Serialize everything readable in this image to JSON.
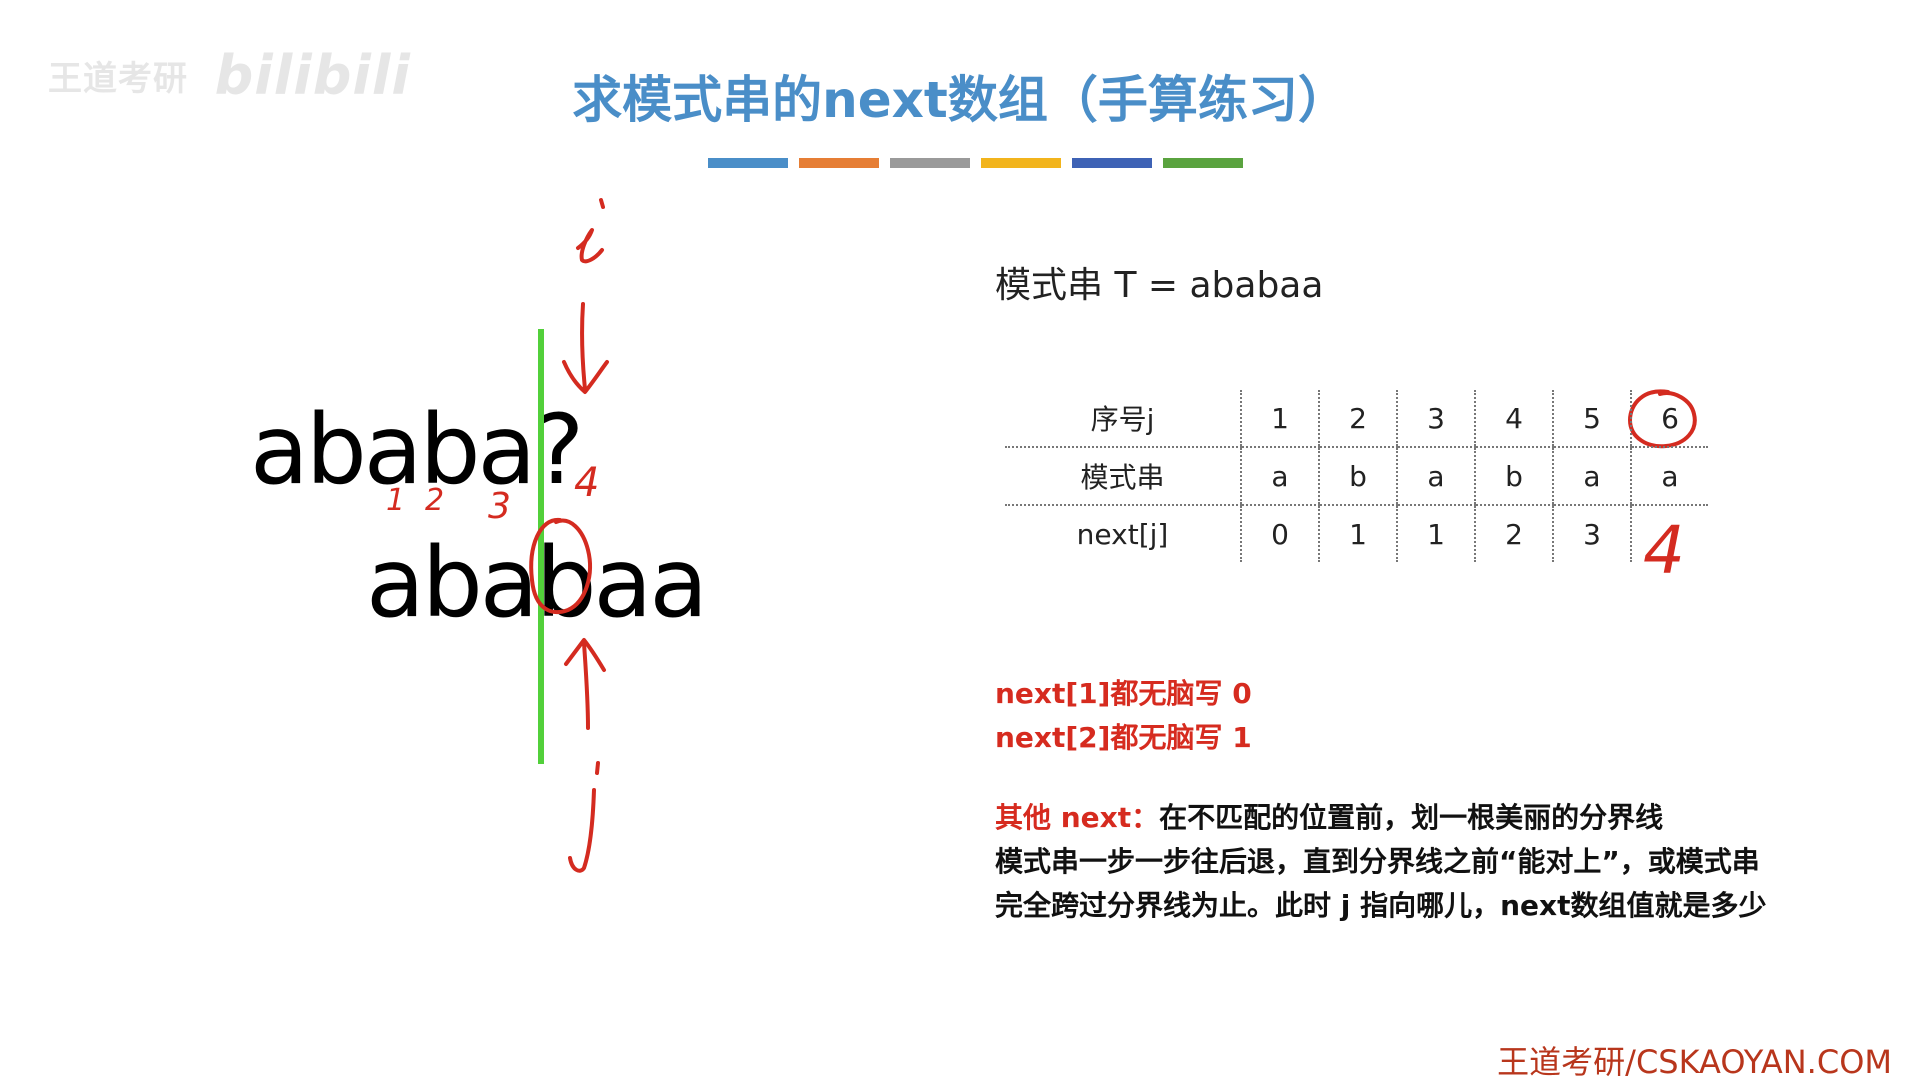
{
  "watermark": {
    "chinese": "王道考研",
    "brand": "bilibili"
  },
  "title": "求模式串的next数组（手算练习）",
  "color_bars": [
    "#4a8ec8",
    "#e67e35",
    "#9a9a9a",
    "#f2b41c",
    "#3e62b5",
    "#5aa33f"
  ],
  "diagram": {
    "main_string": "ababa?",
    "pattern_string": "ababaa",
    "handwritten": {
      "pointer_i": "i",
      "pointer_j": "j",
      "numbers": [
        "1",
        "2",
        "3",
        "4"
      ]
    },
    "divider_color": "#52d03a",
    "ink_color": "#d42b20"
  },
  "pattern_label": "模式串 T = ababaa",
  "table": {
    "rows": [
      {
        "header": "序号j",
        "cells": [
          "1",
          "2",
          "3",
          "4",
          "5",
          "6"
        ]
      },
      {
        "header": "模式串",
        "cells": [
          "a",
          "b",
          "a",
          "b",
          "a",
          "a"
        ]
      },
      {
        "header": "next[j]",
        "cells": [
          "0",
          "1",
          "1",
          "2",
          "3",
          ""
        ]
      }
    ],
    "handwritten_value": "4"
  },
  "rules": {
    "rule1": "next[1]都无脑写 0",
    "rule2": "next[2]都无脑写 1",
    "other_head": "其他 next：",
    "other_line1": "在不匹配的位置前，划一根美丽的分界线",
    "other_line2": "模式串一步一步往后退，直到分界线之前“能对上”，或模式串",
    "other_line3": "完全跨过分界线为止。此时 j 指向哪儿，next数组值就是多少"
  },
  "footer": "王道考研/CSKAOYAN.COM"
}
